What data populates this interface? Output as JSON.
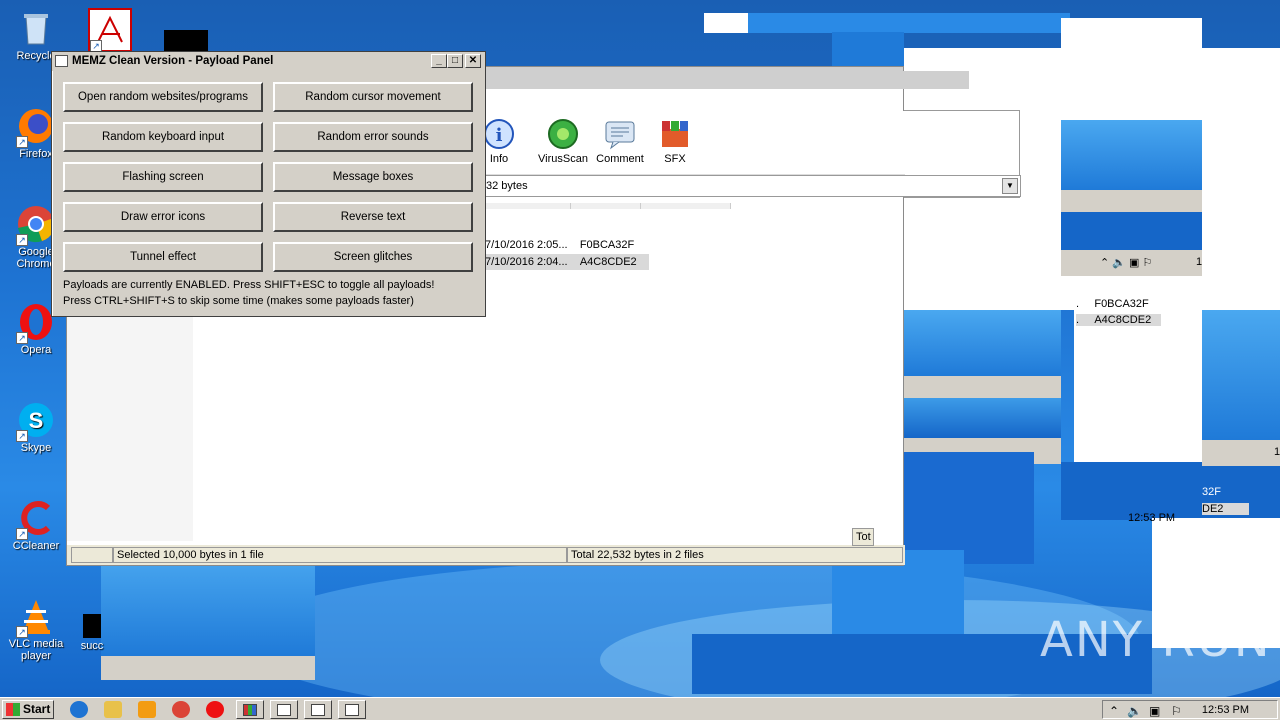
{
  "desktop": {
    "icons": [
      {
        "label": "Recycle",
        "icon": "recycle-bin-icon"
      },
      {
        "label": "Firefox",
        "icon": "firefox-icon"
      },
      {
        "label": "Google Chrome",
        "icon": "chrome-icon"
      },
      {
        "label": "Opera",
        "icon": "opera-icon"
      },
      {
        "label": "Skype",
        "icon": "skype-icon"
      },
      {
        "label": "CCleaner",
        "icon": "ccleaner-icon"
      },
      {
        "label": "VLC media player",
        "icon": "vlc-icon"
      },
      {
        "label": "succ",
        "icon": "app-icon"
      }
    ]
  },
  "memz": {
    "title": "MEMZ Clean Version - Payload Panel",
    "buttons": [
      "Open random websites/programs",
      "Random cursor movement",
      "Random keyboard input",
      "Random error sounds",
      "Flashing screen",
      "Message boxes",
      "Draw error icons",
      "Reverse text",
      "Tunnel effect",
      "Screen glitches"
    ],
    "info_line1": "Payloads are currently ENABLED. Press SHIFT+ESC to toggle all payloads!",
    "info_line2": "Press CTRL+SHIFT+S to skip some time (makes some payloads faster)"
  },
  "winrar": {
    "toolbar": [
      "Info",
      "VirusScan",
      "Comment",
      "SFX"
    ],
    "address": "32 bytes",
    "rows": [
      {
        "modified": "7/10/2016 2:05...",
        "crc": "F0BCA32F"
      },
      {
        "modified": "7/10/2016 2:04...",
        "crc": "A4C8CDE2"
      }
    ],
    "status_left": "Selected 10,000 bytes in 1 file",
    "status_right": "Total 22,532 bytes in 2 files",
    "status_cut": "Tot"
  },
  "glitch_copies": {
    "crc1": "F0BCA32F",
    "crc2": "A4C8CDE2",
    "crc_partial1": "32F",
    "crc_partial2": "DE2",
    "time_partial": "12:53 PM",
    "tray_num": "1"
  },
  "taskbar": {
    "start_label": "Start",
    "clock": "12:53 PM"
  },
  "watermark": "ANY RUN"
}
